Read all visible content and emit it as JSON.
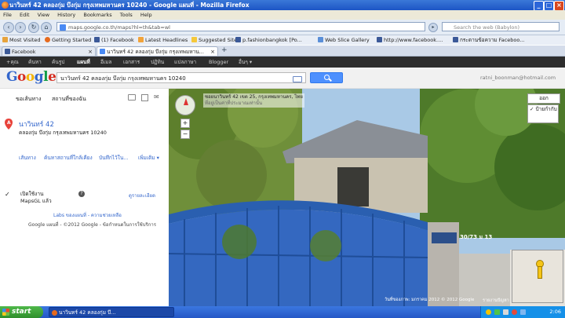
{
  "window": {
    "title": "นาวินทร์ 42 คลองกุ่ม บึงกุ่ม กรุงเทพมหานคร 10240 - Google แผนที่ - Mozilla Firefox",
    "controls": {
      "minimize": "_",
      "maximize": "□",
      "close": "×"
    }
  },
  "menubar": [
    "File",
    "Edit",
    "View",
    "History",
    "Bookmarks",
    "Tools",
    "Help"
  ],
  "navbar": {
    "url": "maps.google.co.th/maps?hl=th&tab=wl",
    "search_placeholder": "Search the web (Babylon)"
  },
  "bookmarks": [
    "Most Visited",
    "Getting Started",
    "(1) Facebook",
    "Latest Headlines",
    "Suggested Sites",
    "p.fashionbangkok [Po...",
    "Web Slice Gallery",
    "http://www.facebook....",
    "กระดานข้อความ Faceboo..."
  ],
  "tabs": [
    {
      "label": "Facebook",
      "active": false
    },
    {
      "label": "นาวินทร์ 42 คลองกุ่ม บึงกุ่ม กรุงเทพมหาน...",
      "active": true
    }
  ],
  "new_tab": "+",
  "google_bar": [
    "+คุณ",
    "ค้นหา",
    "ค้นรูป",
    "แผนที่",
    "อีเมล",
    "เอกสาร",
    "ปฏิทิน",
    "แปลภาษา",
    "Blogger",
    "อื่นๆ ▾"
  ],
  "google": {
    "logo": "Google",
    "search_value": "นาวินทร์ 42 คลองกุ่ม บึงกุ่ม กรุงเทพมหานคร 10240",
    "user": "ratni_boonman@hotmail.com"
  },
  "left_panel": {
    "get_directions": "ขอเส้นทาง",
    "my_places": "สถานที่ของฉัน",
    "marker": "A",
    "place_title": "นาวินทร์ 42",
    "place_address": "คลองกุ่ม บึงกุ่ม กรุงเทพมหานคร 10240",
    "actions": [
      "เส้นทาง",
      "ค้นหาสถานที่ใกล้เคียง",
      "บันทึกไว้ใน...",
      "เพิ่มเติม ▾"
    ],
    "mapsgl_label": "เปิดใช้งาน MapsGL แล้ว",
    "mapsgl_help": "?",
    "mapsgl_more": "ดูรายละเอียด",
    "labs_links": "Labs ของแผนที่ - ความช่วยเหลือ",
    "footer": "Google แผนที่ - ©2012 Google - ข้อกำหนดในการใช้บริการ"
  },
  "street_view": {
    "address_line1": "ซอยนาวินทร์ 42 เขต 25, กรุงเทพมหานคร, ไทย",
    "address_line2": "ที่อยู่เป็นค่าที่ประมาณเท่านั้น",
    "exit_label": "ออก",
    "check_label": "ป้ายกำกับ",
    "house_number": "30/73 ม 13",
    "image_date": "วันที่ของภาพ: มกราคม 2012 © 2012 Google",
    "report_link": "รายงานปัญหา"
  },
  "taskbar": {
    "start": "start",
    "task": "นาวินทร์ 42 คลองกุ่ม บึ...",
    "clock": "2:06"
  }
}
